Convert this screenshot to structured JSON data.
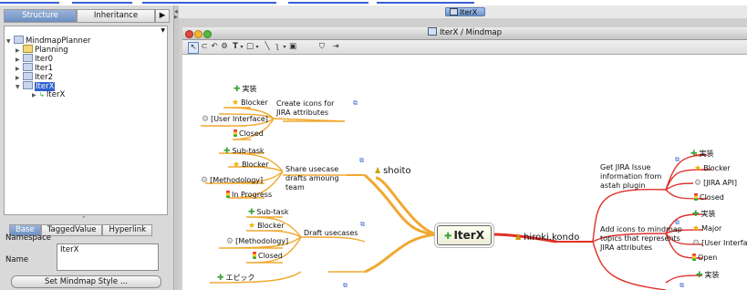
{
  "outer_window": {
    "tab_label": "IterX"
  },
  "left_panel": {
    "tabs": [
      "Structure",
      "Inheritance"
    ],
    "tree": [
      {
        "label": "MindmapPlanner",
        "icon": "project-icon",
        "expanded": true
      },
      {
        "label": "Planning",
        "icon": "folder-icon"
      },
      {
        "label": "Iter0",
        "icon": "diagram-icon"
      },
      {
        "label": "Iter1",
        "icon": "diagram-icon"
      },
      {
        "label": "Iter2",
        "icon": "diagram-icon"
      },
      {
        "label": "IterX",
        "icon": "diagram-icon",
        "selected": true,
        "expanded": true
      },
      {
        "label": "IterX",
        "icon": "topic-icon"
      }
    ],
    "property_tabs": [
      "Base",
      "TaggedValue",
      "Hyperlink"
    ],
    "namespace_label": "Namespace",
    "name_label": "Name",
    "name_value": "IterX",
    "set_style_button": "Set Mindmap Style ..."
  },
  "diagram_window": {
    "title": "IterX / Mindmap",
    "toolbar_icons": [
      "select-arrow-icon",
      "lasso-icon",
      "undo-icon",
      "redo-icon",
      "stamp-icon",
      "text-icon",
      "dropdown-icon",
      "rectangle-icon",
      "dropdown-icon",
      "line-icon",
      "connector-icon",
      "dropdown-icon",
      "image-icon",
      "structure-icon",
      "layout-icon"
    ]
  },
  "mindmap": {
    "center": "IterX",
    "topics": {
      "shoito": "shoito",
      "hiroki": "hiroki.kondo",
      "create_icons": "Create icons for JIRA attributes",
      "share_usecase": "Share usecase drafts amoung team",
      "draft_usecases": "Draft usecases",
      "get_jira": "Get JIRA Issue information from astah plugin",
      "add_icons": "Add icons to mindmap topics that represents JIRA attributes"
    },
    "leaves": {
      "t1": [
        "実装",
        "Blocker",
        "[User Interface]",
        "Closed"
      ],
      "t2": [
        "Sub-task",
        "Blocker",
        "[Methodology]",
        "In Progress"
      ],
      "t3": [
        "Sub-task",
        "Blocker",
        "[Methodology]",
        "Closed"
      ],
      "t4": [
        "エピック"
      ],
      "r1": [
        "実装",
        "Blocker",
        "[JIRA API]",
        "Closed"
      ],
      "r2": [
        "実装",
        "Major",
        "[User Interfa",
        "Open"
      ],
      "r3": [
        "実装"
      ]
    },
    "colors": {
      "orange": "#f0a830",
      "red": "#e0302a",
      "center_border": "#666666"
    }
  }
}
